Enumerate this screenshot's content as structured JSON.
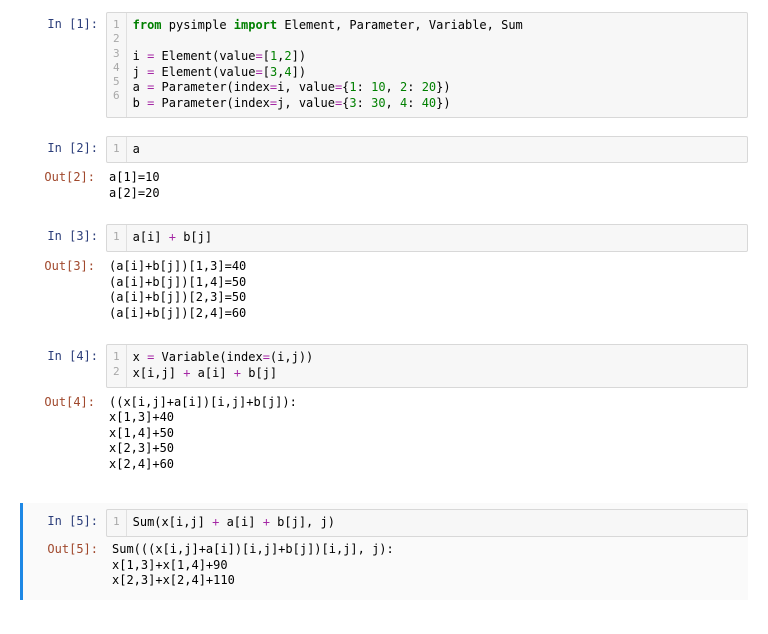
{
  "cells": [
    {
      "prompt_in": "In [1]:",
      "gutter": "1\n2\n3\n4\n5\n6",
      "lines": [
        {
          "segments": [
            {
              "cls": "kw",
              "t": "from"
            },
            {
              "cls": "",
              "t": " pysimple "
            },
            {
              "cls": "kw",
              "t": "import"
            },
            {
              "cls": "",
              "t": " Element, Parameter, Variable, Sum"
            }
          ]
        },
        {
          "segments": [
            {
              "cls": "",
              "t": ""
            }
          ]
        },
        {
          "segments": [
            {
              "cls": "",
              "t": "i "
            },
            {
              "cls": "op",
              "t": "="
            },
            {
              "cls": "",
              "t": " Element(value"
            },
            {
              "cls": "op",
              "t": "="
            },
            {
              "cls": "",
              "t": "["
            },
            {
              "cls": "num",
              "t": "1"
            },
            {
              "cls": "",
              "t": ","
            },
            {
              "cls": "num",
              "t": "2"
            },
            {
              "cls": "",
              "t": "])"
            }
          ]
        },
        {
          "segments": [
            {
              "cls": "",
              "t": "j "
            },
            {
              "cls": "op",
              "t": "="
            },
            {
              "cls": "",
              "t": " Element(value"
            },
            {
              "cls": "op",
              "t": "="
            },
            {
              "cls": "",
              "t": "["
            },
            {
              "cls": "num",
              "t": "3"
            },
            {
              "cls": "",
              "t": ","
            },
            {
              "cls": "num",
              "t": "4"
            },
            {
              "cls": "",
              "t": "])"
            }
          ]
        },
        {
          "segments": [
            {
              "cls": "",
              "t": "a "
            },
            {
              "cls": "op",
              "t": "="
            },
            {
              "cls": "",
              "t": " Parameter(index"
            },
            {
              "cls": "op",
              "t": "="
            },
            {
              "cls": "",
              "t": "i, value"
            },
            {
              "cls": "op",
              "t": "="
            },
            {
              "cls": "",
              "t": "{"
            },
            {
              "cls": "num",
              "t": "1"
            },
            {
              "cls": "",
              "t": ": "
            },
            {
              "cls": "num",
              "t": "10"
            },
            {
              "cls": "",
              "t": ", "
            },
            {
              "cls": "num",
              "t": "2"
            },
            {
              "cls": "",
              "t": ": "
            },
            {
              "cls": "num",
              "t": "20"
            },
            {
              "cls": "",
              "t": "})"
            }
          ]
        },
        {
          "segments": [
            {
              "cls": "",
              "t": "b "
            },
            {
              "cls": "op",
              "t": "="
            },
            {
              "cls": "",
              "t": " Parameter(index"
            },
            {
              "cls": "op",
              "t": "="
            },
            {
              "cls": "",
              "t": "j, value"
            },
            {
              "cls": "op",
              "t": "="
            },
            {
              "cls": "",
              "t": "{"
            },
            {
              "cls": "num",
              "t": "3"
            },
            {
              "cls": "",
              "t": ": "
            },
            {
              "cls": "num",
              "t": "30"
            },
            {
              "cls": "",
              "t": ", "
            },
            {
              "cls": "num",
              "t": "4"
            },
            {
              "cls": "",
              "t": ": "
            },
            {
              "cls": "num",
              "t": "40"
            },
            {
              "cls": "",
              "t": "})"
            }
          ]
        }
      ]
    },
    {
      "prompt_in": "In [2]:",
      "gutter": "1",
      "lines": [
        {
          "segments": [
            {
              "cls": "",
              "t": "a"
            }
          ]
        }
      ],
      "prompt_out": "Out[2]:",
      "output": "a[1]=10\na[2]=20"
    },
    {
      "prompt_in": "In [3]:",
      "gutter": "1",
      "lines": [
        {
          "segments": [
            {
              "cls": "",
              "t": "a[i] "
            },
            {
              "cls": "op",
              "t": "+"
            },
            {
              "cls": "",
              "t": " b[j]"
            }
          ]
        }
      ],
      "prompt_out": "Out[3]:",
      "output": "(a[i]+b[j])[1,3]=40\n(a[i]+b[j])[1,4]=50\n(a[i]+b[j])[2,3]=50\n(a[i]+b[j])[2,4]=60"
    },
    {
      "prompt_in": "In [4]:",
      "gutter": "1\n2",
      "lines": [
        {
          "segments": [
            {
              "cls": "",
              "t": "x "
            },
            {
              "cls": "op",
              "t": "="
            },
            {
              "cls": "",
              "t": " Variable(index"
            },
            {
              "cls": "op",
              "t": "="
            },
            {
              "cls": "",
              "t": "(i,j))"
            }
          ]
        },
        {
          "segments": [
            {
              "cls": "",
              "t": "x[i,j] "
            },
            {
              "cls": "op",
              "t": "+"
            },
            {
              "cls": "",
              "t": " a[i] "
            },
            {
              "cls": "op",
              "t": "+"
            },
            {
              "cls": "",
              "t": " b[j]"
            }
          ]
        }
      ],
      "prompt_out": "Out[4]:",
      "output": "((x[i,j]+a[i])[i,j]+b[j]):\nx[1,3]+40\nx[1,4]+50\nx[2,3]+50\nx[2,4]+60"
    },
    {
      "selected": true,
      "prompt_in": "In [5]:",
      "gutter": "1",
      "lines": [
        {
          "segments": [
            {
              "cls": "",
              "t": "Sum(x[i,j] "
            },
            {
              "cls": "op",
              "t": "+"
            },
            {
              "cls": "",
              "t": " a[i] "
            },
            {
              "cls": "op",
              "t": "+"
            },
            {
              "cls": "",
              "t": " b[j], j)"
            }
          ]
        }
      ],
      "prompt_out": "Out[5]:",
      "output": "Sum(((x[i,j]+a[i])[i,j]+b[j])[i,j], j):\nx[1,3]+x[1,4]+90\nx[2,3]+x[2,4]+110"
    }
  ]
}
